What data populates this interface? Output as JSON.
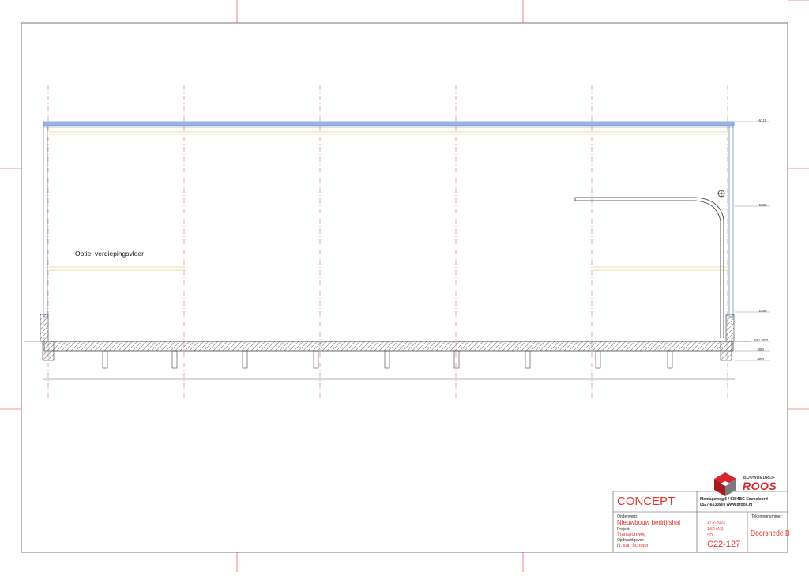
{
  "drawing": {
    "option_label": "Optie: verdiepingsvloer",
    "levels": [
      "+6115",
      "+5680",
      "+1600",
      "MV -300",
      "-360",
      "-850"
    ]
  },
  "titleblock": {
    "status": "CONCEPT",
    "company_name": "BOUWBEDRIJF",
    "company_logo_text": "ROOS",
    "address": "Moniageweg 6 / 8304BG Emmeloord",
    "contact": "0527-613390 / www.broos.nl",
    "subject_label": "Onderwerp:",
    "subject_value": "Nieuwbouw bedrijfshal",
    "project_label": "Project:",
    "project_value": "Transportweg",
    "client_label": "Opdrachtgever:",
    "client_value": "N. van Schoten",
    "date": "17-2-2023",
    "scale": "1:50 (A3)",
    "author": "SD",
    "drawing_number_label": "Tekeningnummer:",
    "drawing_title": "Doorsnede B",
    "drawing_number": "C22-127"
  },
  "colors": {
    "accent_red": "#e8322f",
    "roof_blue": "#6f93d3",
    "logo_red": "#d9262c",
    "logo_grey": "#7a7a7a"
  }
}
